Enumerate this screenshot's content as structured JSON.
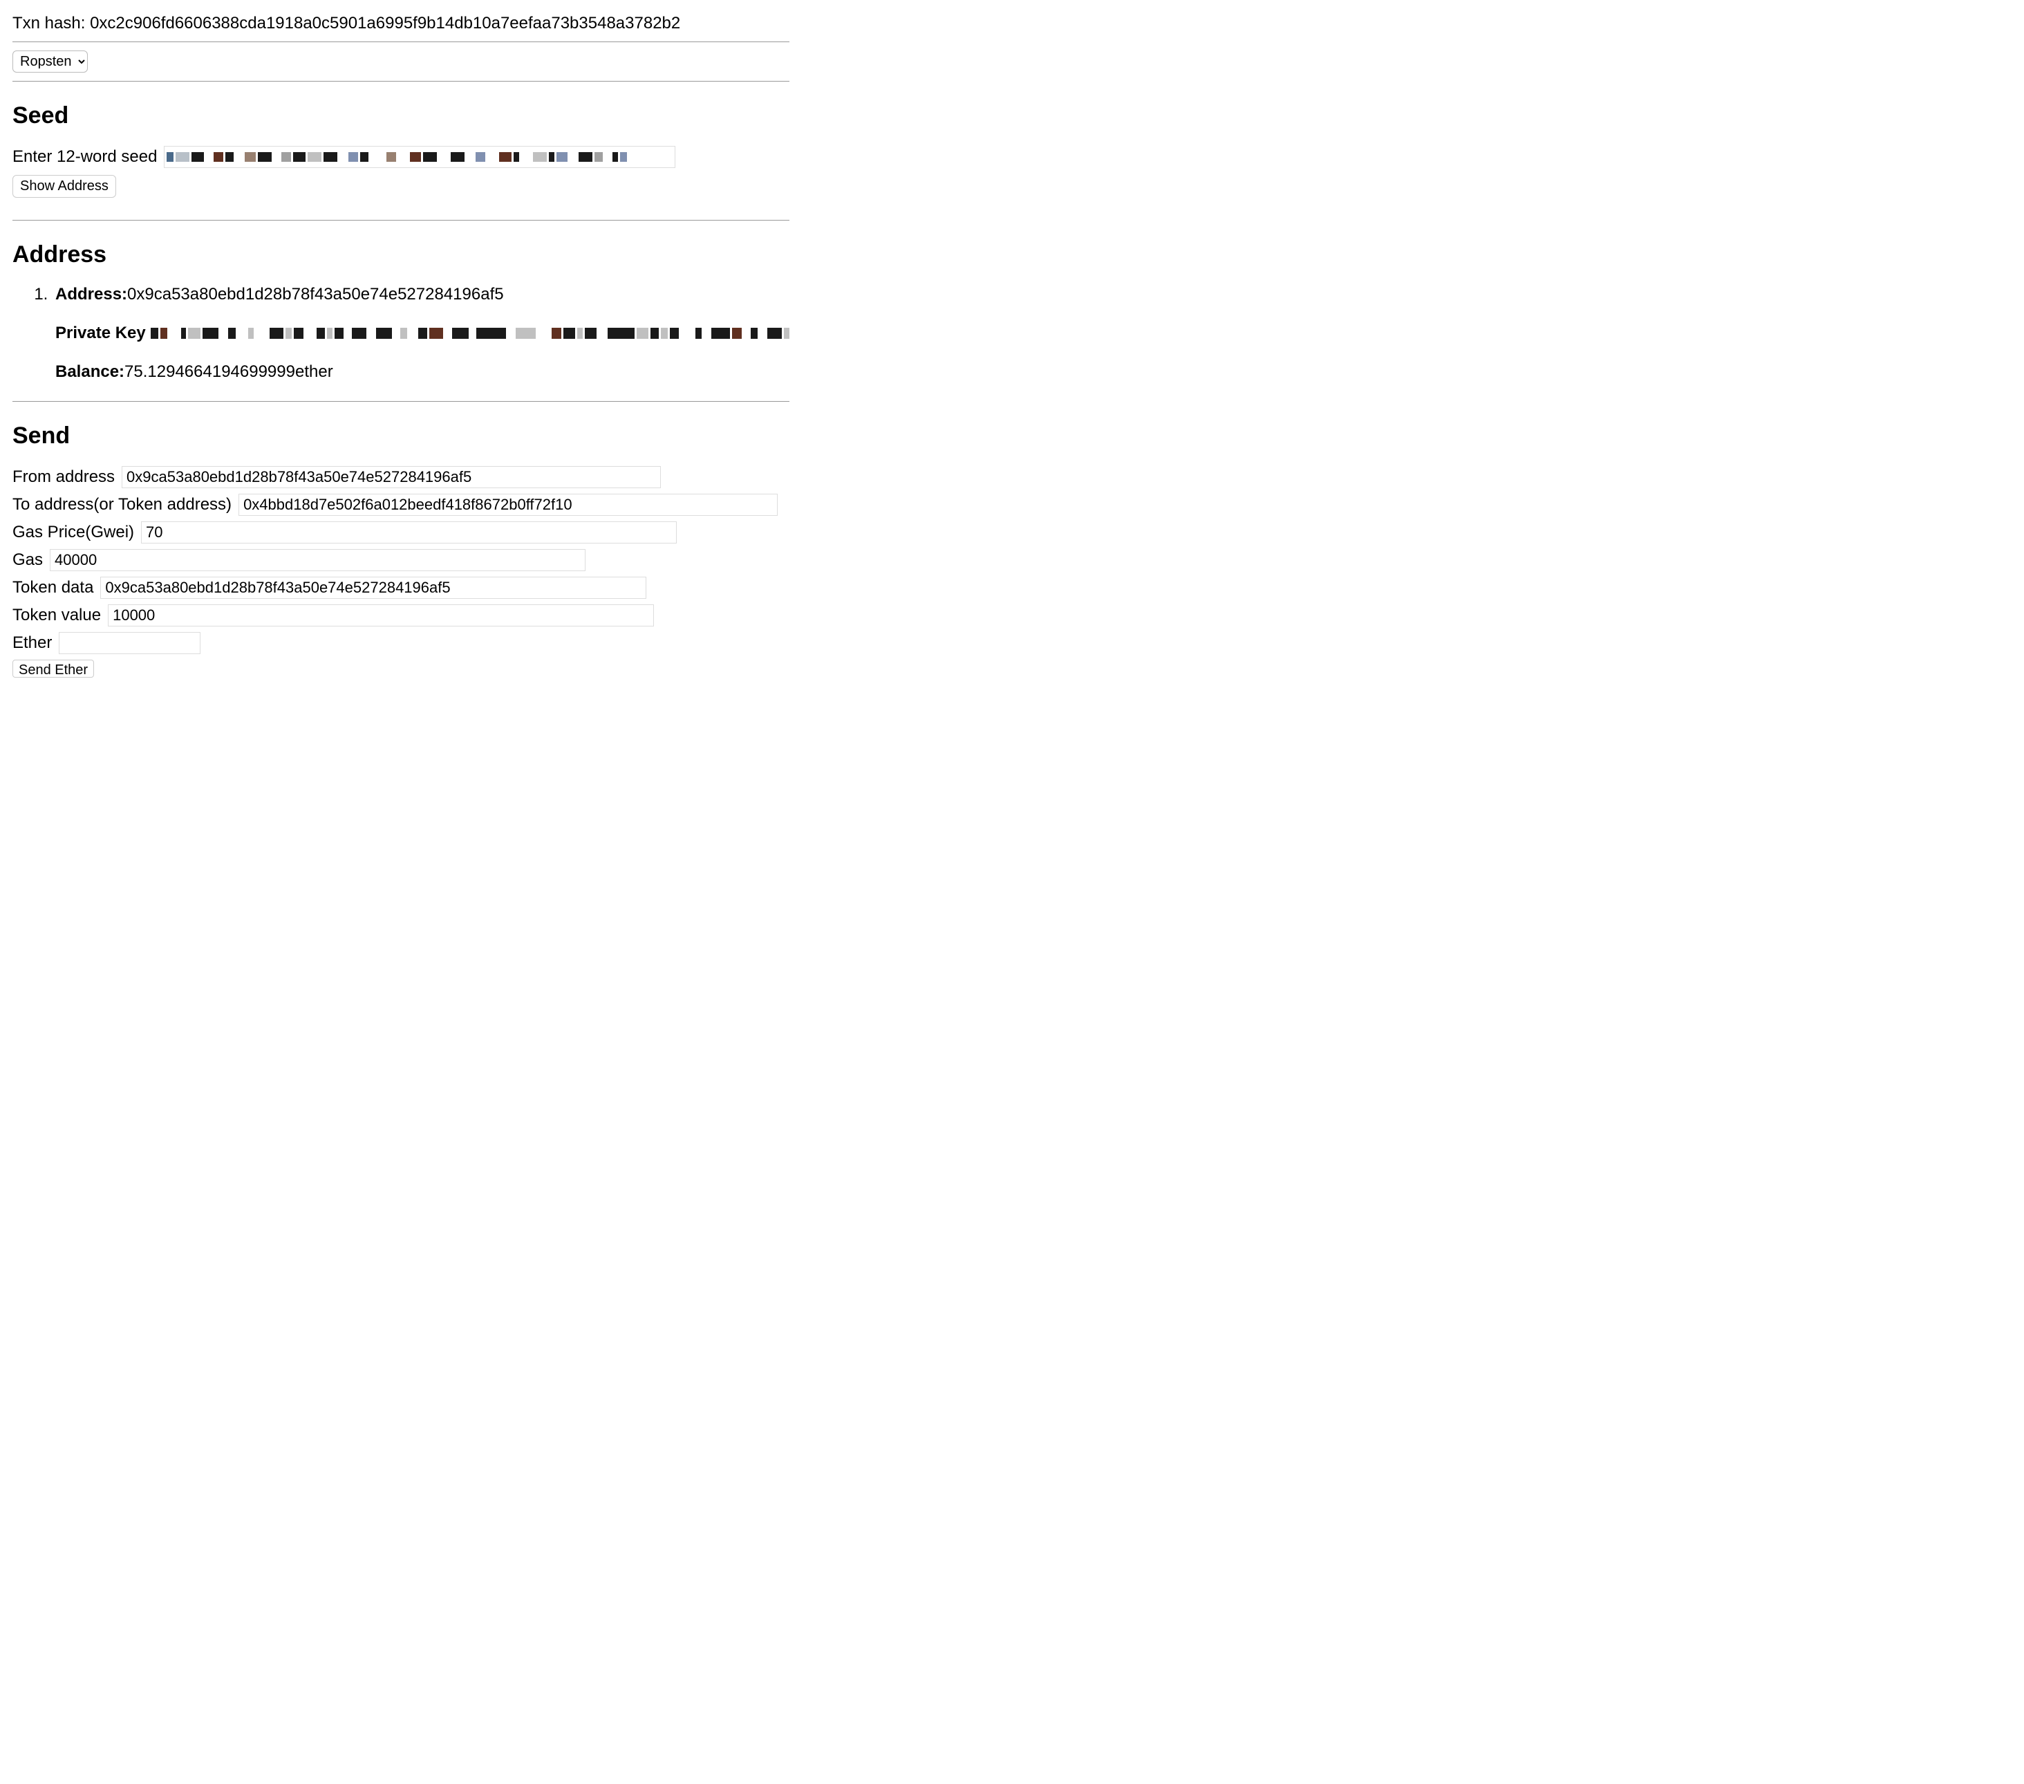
{
  "txn": {
    "label": "Txn hash: ",
    "hash": "0xc2c906fd6606388cda1918a0c5901a6995f9b14db10a7eefaa73b3548a3782b2"
  },
  "network": {
    "selected": "Ropsten"
  },
  "seed": {
    "heading": "Seed",
    "label": "Enter 12-word seed",
    "show_button": "Show Address"
  },
  "address": {
    "heading": "Address",
    "address_label": "Address:",
    "address_value": "0x9ca53a80ebd1d28b78f43a50e74e527284196af5",
    "private_key_label": "Private Key",
    "balance_label": "Balance:",
    "balance_value": "75.1294664194699999",
    "balance_unit": "ether"
  },
  "send": {
    "heading": "Send",
    "from_label": "From address",
    "from_value": "0x9ca53a80ebd1d28b78f43a50e74e527284196af5",
    "to_label": "To address(or Token address)",
    "to_value": "0x4bbd18d7e502f6a012beedf418f8672b0ff72f10",
    "gas_price_label": "Gas Price(Gwei)",
    "gas_price_value": "70",
    "gas_label": "Gas",
    "gas_value": "40000",
    "token_data_label": "Token data",
    "token_data_value": "0x9ca53a80ebd1d28b78f43a50e74e527284196af5",
    "token_value_label": "Token value",
    "token_value_value": "10000",
    "ether_label": "Ether",
    "ether_value": "",
    "send_button": "Send Ether"
  }
}
